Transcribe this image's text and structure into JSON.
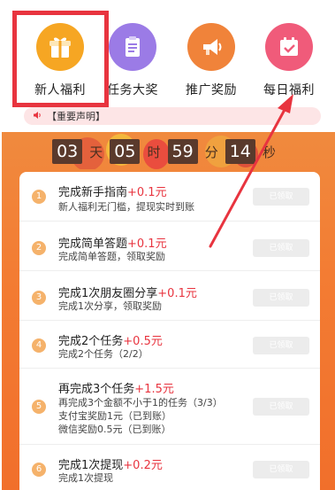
{
  "nav": {
    "items": [
      {
        "label": "新人福利",
        "icon": "gift-icon",
        "color": "#f6a623"
      },
      {
        "label": "任务大奖",
        "icon": "clipboard-icon",
        "color": "#9b7be6"
      },
      {
        "label": "推广奖励",
        "icon": "megaphone-icon",
        "color": "#f0833a"
      },
      {
        "label": "每日福利",
        "icon": "calendar-check-icon",
        "color": "#f05b7a"
      }
    ]
  },
  "notice": {
    "text": "【重要声明】"
  },
  "countdown": {
    "days": "03",
    "day_unit": "天",
    "hours": "05",
    "hour_unit": "时",
    "minutes": "59",
    "minute_unit": "分",
    "seconds": "14",
    "second_unit": "秒"
  },
  "tasks": [
    {
      "num": "1",
      "title": "完成新手指南",
      "bonus": "+0.1元",
      "lines": [
        "新人福利无门槛，提现实时到账"
      ],
      "button": "已领取"
    },
    {
      "num": "2",
      "title": "完成简单答题",
      "bonus": "+0.1元",
      "lines": [
        "完成简单答题，领取奖励"
      ],
      "button": "已领取"
    },
    {
      "num": "3",
      "title": "完成1次朋友圈分享",
      "bonus": "+0.1元",
      "lines": [
        "完成1次分享，领取奖励"
      ],
      "button": "已领取"
    },
    {
      "num": "4",
      "title": "完成2个任务",
      "bonus": "+0.5元",
      "lines": [
        "完成2个任务（2/2）"
      ],
      "button": "已领取"
    },
    {
      "num": "5",
      "title": "再完成3个任务",
      "bonus": "+1.5元",
      "lines": [
        "再完成3个金额不小于1的任务（3/3）",
        "支付宝奖励1元（已到账）",
        "微信奖励0.5元（已到账）"
      ],
      "button": "已领取"
    },
    {
      "num": "6",
      "title": "完成1次提现",
      "bonus": "+0.2元",
      "lines": [
        "完成1次提现"
      ],
      "button": "已领取"
    }
  ],
  "colors": {
    "accent_red": "#e8343f",
    "orange": "#f37c33",
    "badge": "#f5b26b"
  }
}
